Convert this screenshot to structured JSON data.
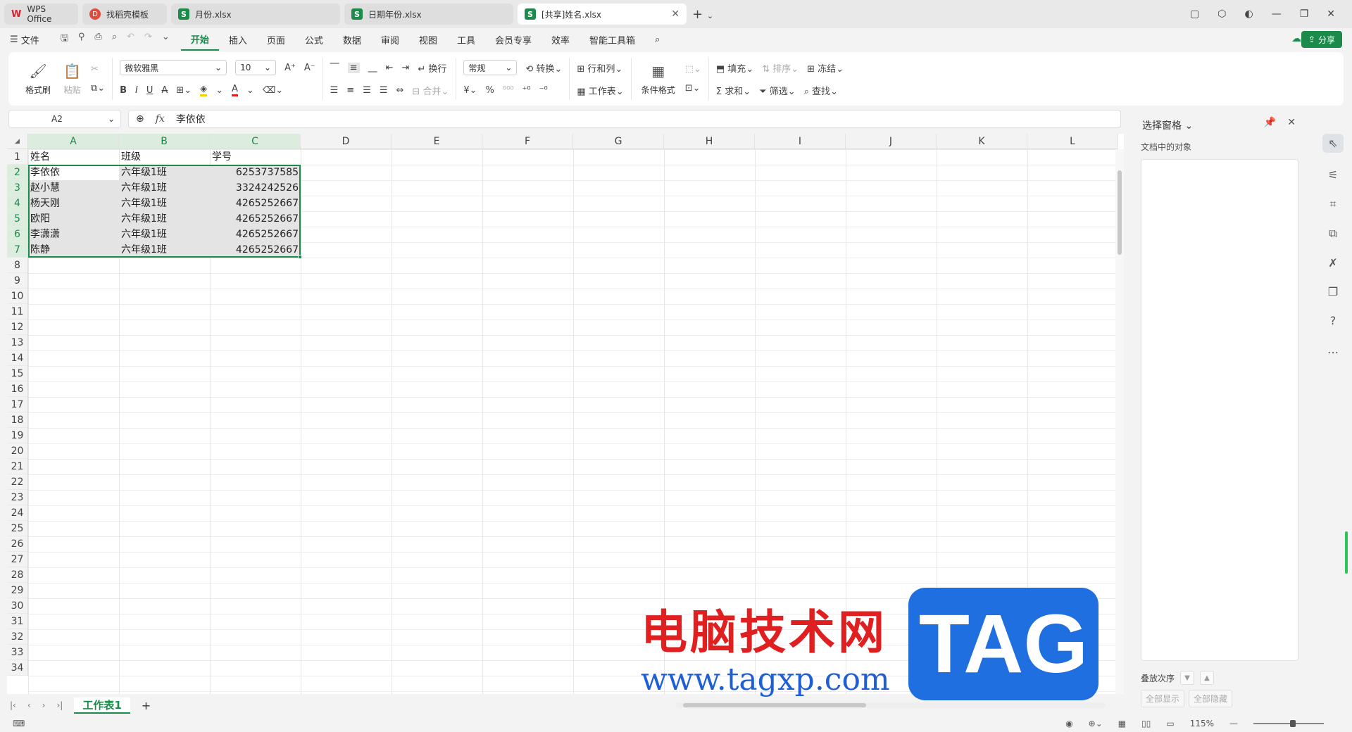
{
  "tabs": [
    {
      "label": "WPS Office",
      "icon": "wps-logo-icon"
    },
    {
      "label": "找稻壳模板",
      "icon": "docer-icon"
    },
    {
      "label": "月份.xlsx",
      "icon": "sheet-icon"
    },
    {
      "label": "日期年份.xlsx",
      "icon": "sheet-icon"
    },
    {
      "label": "[共享]姓名.xlsx",
      "icon": "sheet-icon"
    }
  ],
  "tab_icon_letters": {
    "wps": "W",
    "sheet": "S",
    "docer": "D"
  },
  "menu": {
    "file": "文件",
    "items": [
      "开始",
      "插入",
      "页面",
      "公式",
      "数据",
      "审阅",
      "视图",
      "工具",
      "会员专享",
      "效率",
      "智能工具箱"
    ],
    "active": "开始",
    "share": "分享"
  },
  "ribbon": {
    "format_painter": "格式刷",
    "paste": "粘贴",
    "font_name": "微软雅黑",
    "font_size": "10",
    "wrap": "换行",
    "merge": "合并",
    "number_format": "常规",
    "convert": "转换",
    "rows_cols": "行和列",
    "worksheet": "工作表",
    "conditional": "条件格式",
    "fill": "填充",
    "sort": "排序",
    "freeze": "冻结",
    "sum": "求和",
    "filter": "筛选",
    "find": "查找"
  },
  "formula_bar": {
    "cell_ref": "A2",
    "fx": "fx",
    "value": "李依依"
  },
  "columns": [
    "A",
    "B",
    "C",
    "D",
    "E",
    "F",
    "G",
    "H",
    "I",
    "J",
    "K",
    "L"
  ],
  "row_count": 34,
  "table": {
    "header": [
      "姓名",
      "班级",
      "学号"
    ],
    "rows": [
      [
        "李依依",
        "六年级1班",
        "6253737585"
      ],
      [
        "赵小慧",
        "六年级1班",
        "3324242526"
      ],
      [
        "杨天刚",
        "六年级1班",
        "4265252667"
      ],
      [
        "欧阳",
        "六年级1班",
        "4265252667"
      ],
      [
        "李潇潇",
        "六年级1班",
        "4265252667"
      ],
      [
        "陈静",
        "六年级1班",
        "4265252667"
      ]
    ]
  },
  "sheet_tab": "工作表1",
  "status": {
    "zoom": "115%"
  },
  "panel": {
    "title": "选择窗格",
    "subtitle": "文档中的对象",
    "order_label": "叠放次序",
    "show_all": "全部显示",
    "hide_all": "全部隐藏"
  },
  "watermark": {
    "title": "电脑技术网",
    "url": "www.tagxp.com",
    "tag": "TAG"
  },
  "colors": {
    "accent": "#1c8a4b",
    "selection_fill": "#e4e4e4",
    "watermark_red": "#e02020",
    "watermark_blue": "#1f6fe0"
  }
}
